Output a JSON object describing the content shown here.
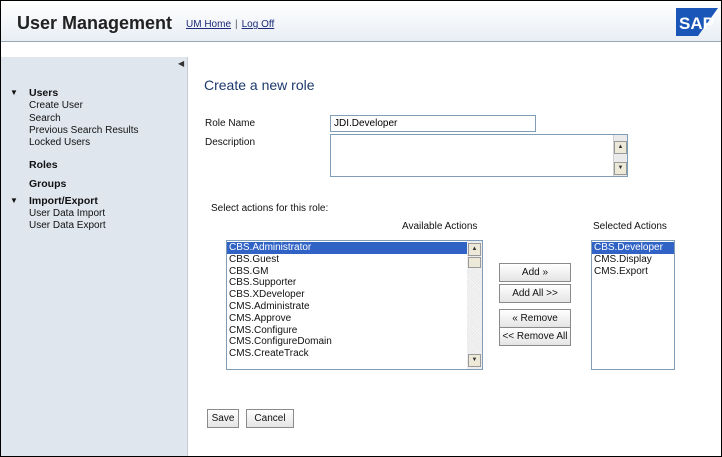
{
  "header": {
    "title": "User Management",
    "links": [
      "UM Home",
      "Log Off"
    ],
    "logo_text": "SAP"
  },
  "sidebar": {
    "collapse_icon": "left-triangle",
    "users_group": "Users",
    "users_items": [
      "Create User",
      "Search",
      "Previous Search Results",
      "Locked Users"
    ],
    "roles": "Roles",
    "groups": "Groups",
    "import_group": "Import/Export",
    "import_items": [
      "User Data Import",
      "User Data Export"
    ]
  },
  "form": {
    "title": "Create a new role",
    "role_name_label": "Role Name",
    "role_name_value": "JDI.Developer",
    "description_label": "Description",
    "description_value": "",
    "select_actions_label": "Select actions for this role:",
    "available_label": "Available Actions",
    "selected_label": "Selected Actions",
    "available": [
      "CBS.Administrator",
      "CBS.Guest",
      "CBS.GM",
      "CBS.Supporter",
      "CBS.XDeveloper",
      "CMS.Administrate",
      "CMS.Approve",
      "CMS.Configure",
      "CMS.ConfigureDomain",
      "CMS.CreateTrack"
    ],
    "available_selected_index": 0,
    "selected": [
      "CBS.Developer",
      "CMS.Display",
      "CMS.Export"
    ],
    "selected_selected_index": 0,
    "buttons": {
      "add": "Add »",
      "add_all": "Add All >>",
      "remove": "« Remove",
      "remove_all": "<< Remove All",
      "save": "Save",
      "cancel": "Cancel"
    }
  },
  "colors": {
    "accent": "#1c3a6e",
    "selection": "#3163c6",
    "sidebar_bg": "#dfe6ee",
    "logo": "#1a56b8"
  }
}
